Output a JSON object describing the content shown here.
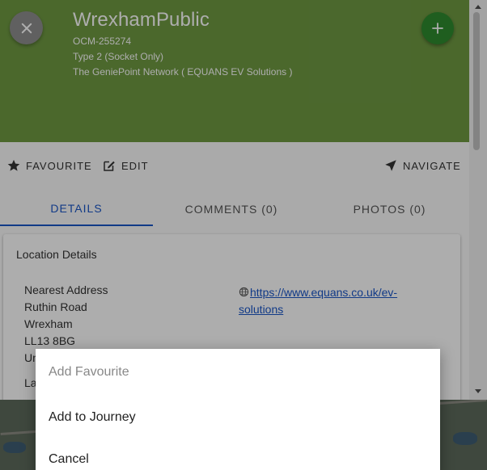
{
  "station": {
    "title": "WrexhamPublic",
    "id": "OCM-255274",
    "connection": "Type 2 (Socket Only)",
    "network": "The GeniePoint Network ( EQUANS EV Solutions )"
  },
  "actions": {
    "favourite": "FAVOURITE",
    "edit": "EDIT",
    "navigate": "NAVIGATE"
  },
  "tabs": [
    {
      "label": "DETAILS",
      "active": true
    },
    {
      "label": "COMMENTS (0)",
      "active": false
    },
    {
      "label": "PHOTOS (0)",
      "active": false
    }
  ],
  "location": {
    "heading": "Location Details",
    "address_lines": [
      "Nearest Address",
      "Ruthin Road",
      "Wrexham",
      "LL13 8BG",
      "Un"
    ],
    "partial_label": "La",
    "website_line1": "https://www.equans.co.uk/ev-",
    "website_line2": "solutions"
  },
  "dialog": {
    "items": [
      "Add Favourite",
      "Add to Journey",
      "Cancel"
    ]
  },
  "colors": {
    "header_bg": "#6f9a42",
    "add_button": "#2e8b2e",
    "accent_blue": "#1a56c8"
  },
  "icons": {
    "close": "close-icon",
    "add": "plus-icon",
    "favourite": "star-icon",
    "edit": "edit-icon",
    "navigate": "navigation-arrow-icon",
    "website": "globe-icon"
  }
}
